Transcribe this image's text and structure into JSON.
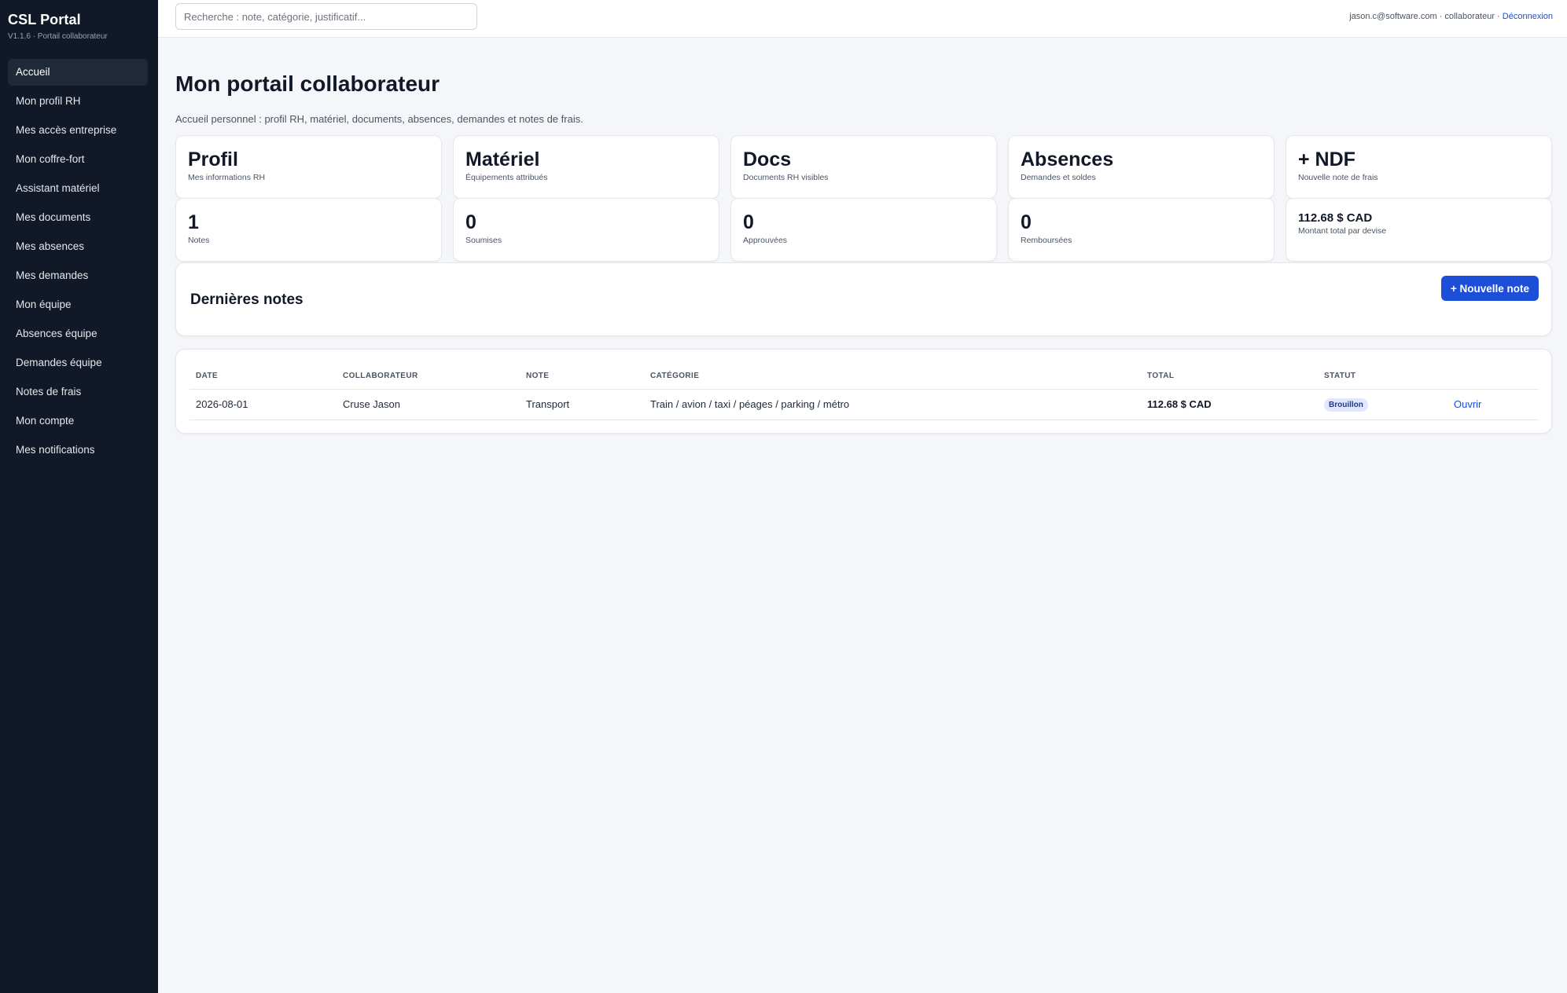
{
  "app": {
    "title": "CSL Portal",
    "subtitle": "V1.1.6 · Portail collaborateur"
  },
  "sidebar": {
    "items": [
      {
        "label": "Accueil",
        "active": true
      },
      {
        "label": "Mon profil RH"
      },
      {
        "label": "Mes accès entreprise"
      },
      {
        "label": "Mon coffre-fort"
      },
      {
        "label": "Assistant matériel"
      },
      {
        "label": "Mes documents"
      },
      {
        "label": "Mes absences"
      },
      {
        "label": "Mes demandes"
      },
      {
        "label": "Mon équipe"
      },
      {
        "label": "Absences équipe"
      },
      {
        "label": "Demandes équipe"
      },
      {
        "label": "Notes de frais"
      },
      {
        "label": "Mon compte"
      },
      {
        "label": "Mes notifications"
      }
    ]
  },
  "topbar": {
    "search_placeholder": "Recherche : note, catégorie, justificatif...",
    "user_info": "jason.c@software.com · collaborateur · ",
    "logout": "Déconnexion"
  },
  "main": {
    "title": "Mon portail collaborateur",
    "subtitle": "Accueil personnel : profil RH, matériel, documents, absences, demandes et notes de frais.",
    "shortcut_cards": [
      {
        "title": "Profil",
        "desc": "Mes informations RH"
      },
      {
        "title": "Matériel",
        "desc": "Équipements attribués"
      },
      {
        "title": "Docs",
        "desc": "Documents RH visibles"
      },
      {
        "title": "Absences",
        "desc": "Demandes et soldes"
      },
      {
        "title": "+ NDF",
        "desc": "Nouvelle note de frais"
      }
    ],
    "stat_cards": [
      {
        "value": "1",
        "label": "Notes"
      },
      {
        "value": "0",
        "label": "Soumises"
      },
      {
        "value": "0",
        "label": "Approuvées"
      },
      {
        "value": "0",
        "label": "Remboursées"
      },
      {
        "value": "112.68 $ CAD",
        "label": "Montant total par devise"
      }
    ],
    "notes_panel": {
      "title": "Dernières notes",
      "new_button": "+ Nouvelle note"
    },
    "table": {
      "headers": [
        "DATE",
        "COLLABORATEUR",
        "NOTE",
        "CATÉGORIE",
        "TOTAL",
        "STATUT",
        ""
      ],
      "rows": [
        {
          "date": "2026-08-01",
          "collaborateur": "Cruse Jason",
          "note": "Transport",
          "categorie": "Train / avion / taxi / péages / parking / métro",
          "total": "112.68 $ CAD",
          "statut": "Brouillon",
          "action": "Ouvrir"
        }
      ]
    }
  },
  "colors": {
    "sidebar_bg": "#111827",
    "accent": "#1d4ed8",
    "page_bg": "#f4f6f9",
    "badge_bg": "#e0e7ff"
  }
}
